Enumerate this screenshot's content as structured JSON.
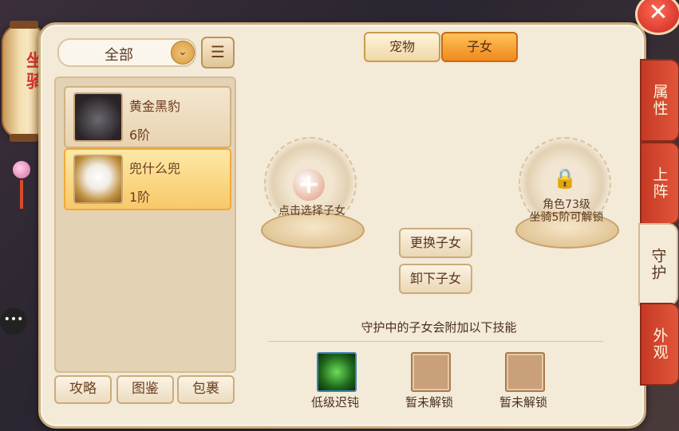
{
  "side": {
    "title": "坐骑"
  },
  "close_symbol": "✕",
  "filter": {
    "label": "全部",
    "chevron": "⌄",
    "list_icon": "☰"
  },
  "mounts": [
    {
      "name": "黄金黑豹",
      "rank": "6阶"
    },
    {
      "name": "兜什么兜",
      "rank": "1阶"
    }
  ],
  "bottom_buttons": [
    "攻略",
    "图鉴",
    "包裹"
  ],
  "top_tabs": [
    "宠物",
    "子女"
  ],
  "slots": {
    "select_text": "点击选择子女",
    "locked_text_line1": "角色73级",
    "locked_text_line2": "坐骑5阶可解锁"
  },
  "buttons": {
    "replace": "更换子女",
    "unload": "卸下子女"
  },
  "description": "守护中的子女会附加以下技能",
  "skills": [
    {
      "label": "低级迟钝",
      "icon": "skill-slow-icon"
    },
    {
      "label": "暂未解锁",
      "icon": "locked-slot-icon"
    },
    {
      "label": "暂未解锁",
      "icon": "locked-slot-icon"
    }
  ],
  "right_tabs": [
    "属性",
    "上阵",
    "守护",
    "外观"
  ],
  "colors": {
    "active_tab": "#ef8a1e",
    "side_tab": "#d6482f",
    "panel": "#f3ead8"
  }
}
